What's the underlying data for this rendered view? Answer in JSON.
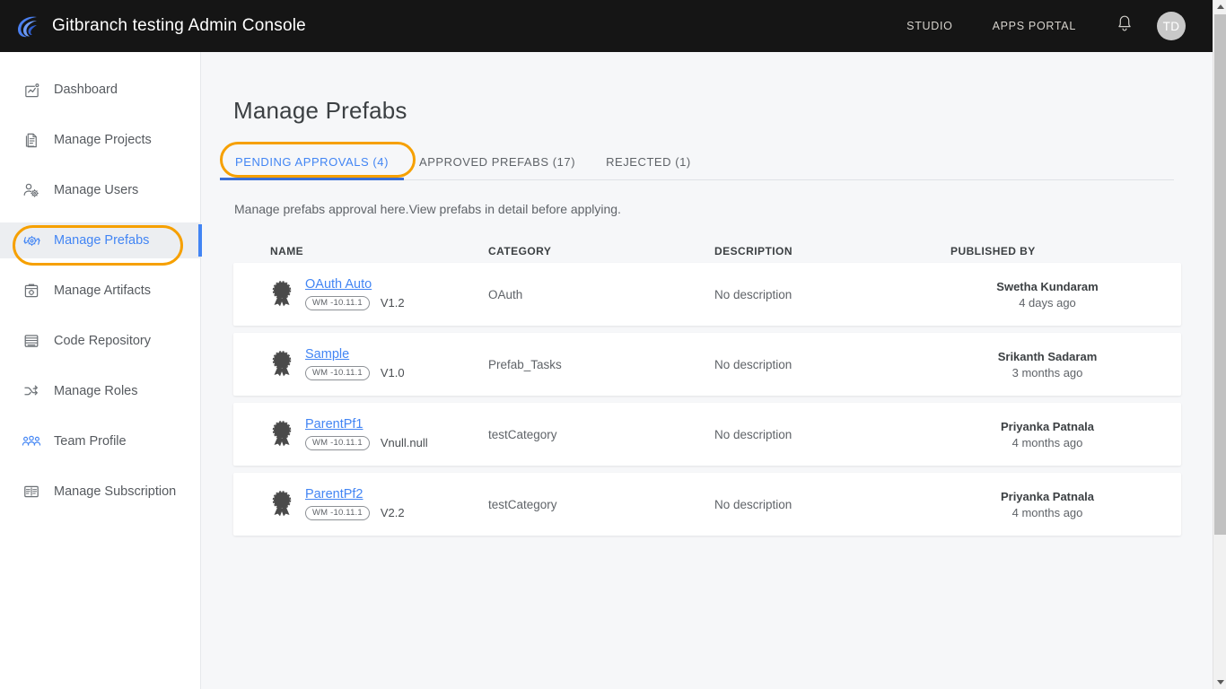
{
  "header": {
    "app_title": "Gitbranch testing Admin Console",
    "logo_icon": "wave-logo-icon",
    "nav": [
      {
        "label": "STUDIO",
        "name": "topnav-studio"
      },
      {
        "label": "APPS PORTAL",
        "name": "topnav-apps-portal"
      }
    ],
    "notification_icon": "bell-icon",
    "avatar_initials": "TD",
    "bar_color": "#151515"
  },
  "sidebar": {
    "items": [
      {
        "label": "Dashboard",
        "icon": "dashboard-chart-icon",
        "active": false
      },
      {
        "label": "Manage Projects",
        "icon": "document-icon",
        "active": false
      },
      {
        "label": "Manage Users",
        "icon": "user-gear-icon",
        "active": false
      },
      {
        "label": "Manage Prefabs",
        "icon": "prefab-gear-refresh-icon",
        "active": true
      },
      {
        "label": "Manage Artifacts",
        "icon": "artifact-box-icon",
        "active": false
      },
      {
        "label": "Code Repository",
        "icon": "repository-icon",
        "active": false
      },
      {
        "label": "Manage Roles",
        "icon": "shuffle-roles-icon",
        "active": false
      },
      {
        "label": "Team Profile",
        "icon": "team-people-icon",
        "active": false
      },
      {
        "label": "Manage Subscription",
        "icon": "subscription-card-icon",
        "active": false
      }
    ],
    "active_color": "#4285f4",
    "highlight_ring_color": "#f6a000"
  },
  "main": {
    "page_title": "Manage Prefabs",
    "tabs": [
      {
        "label": "PENDING APPROVALS (4)",
        "active": true
      },
      {
        "label": "APPROVED PREFABS (17)",
        "active": false
      },
      {
        "label": "REJECTED (1)",
        "active": false
      }
    ],
    "subtitle": "Manage prefabs approval here.View prefabs in detail before applying.",
    "table": {
      "columns": [
        "NAME",
        "CATEGORY",
        "DESCRIPTION",
        "PUBLISHED BY"
      ],
      "rows": [
        {
          "icon": "rosette-award-icon",
          "name": "OAuth Auto",
          "badge": "WM -10.11.1",
          "version": "V1.2",
          "category": "OAuth",
          "description": "No description",
          "published_by": "Swetha Kundaram",
          "published_when": "4 days ago"
        },
        {
          "icon": "rosette-award-icon",
          "name": "Sample",
          "badge": "WM -10.11.1",
          "version": "V1.0",
          "category": "Prefab_Tasks",
          "description": "No description",
          "published_by": "Srikanth Sadaram",
          "published_when": "3 months ago"
        },
        {
          "icon": "rosette-award-icon",
          "name": "ParentPf1",
          "badge": "WM -10.11.1",
          "version": "Vnull.null",
          "category": "testCategory",
          "description": "No description",
          "published_by": "Priyanka Patnala",
          "published_when": "4 months ago"
        },
        {
          "icon": "rosette-award-icon",
          "name": "ParentPf2",
          "badge": "WM -10.11.1",
          "version": "V2.2",
          "category": "testCategory",
          "description": "No description",
          "published_by": "Priyanka Patnala",
          "published_when": "4 months ago"
        }
      ]
    }
  },
  "scrollbar": {
    "up_icon": "scroll-up-arrow-icon",
    "down_icon": "scroll-down-arrow-icon"
  }
}
